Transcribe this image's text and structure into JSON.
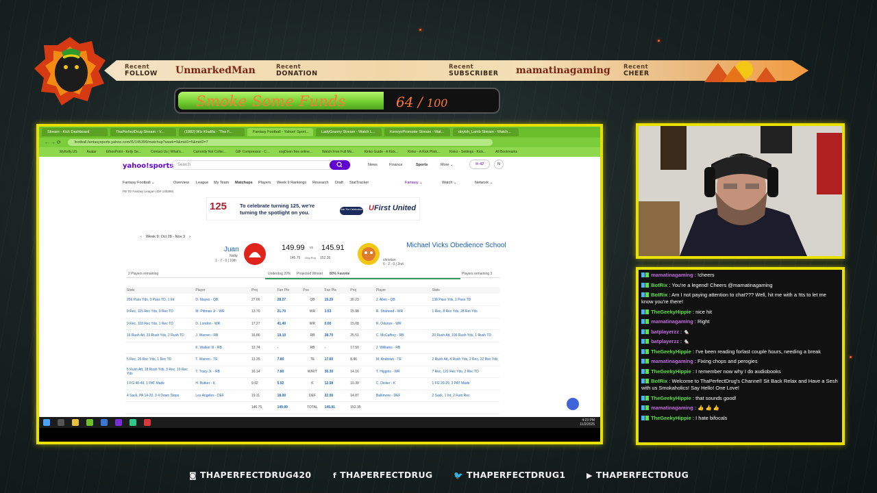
{
  "banner": {
    "follow_label": [
      "Recent",
      "FOLLOW"
    ],
    "follow_name": "UnmarkedMan",
    "donation_label": [
      "Recent",
      "DONATION"
    ],
    "subscriber_label": [
      "Recent",
      "SUBSCRIBER"
    ],
    "subscriber_name": "mamatinagaming",
    "cheer_label": [
      "Recent",
      "CHEER"
    ]
  },
  "goal": {
    "title": "Smoke Some Funds",
    "current": "64",
    "sep": "/",
    "target": "100",
    "progress_fraction": 0.64
  },
  "browser": {
    "tabs": [
      "Stream - Kick Dashboard",
      "ThaPerfectDrug Stream - V...",
      "(1882) Wiz Khalifa - \"The F...",
      "Fantasy Football - Yahoo! Sport...",
      "LadyGranny Stream - Watch L...",
      "KenvynPromoter Stream - Wat...",
      "doylsh_Lamb Stream - Watch..."
    ],
    "url": "football.fantasysports.yahoo.com/f1/145399/matchup?week=9&mid1=5&mid2=7",
    "bookmarks": [
      "MyKelly.US",
      "Avatar",
      "EthosPoint - Kelly Se...",
      "Contact Us | What's...",
      "Currently Not Coller...",
      "GIF Compressor - C...",
      "sogDoon free online...",
      "Watch Free Full Mo...",
      "Kinko Guide - A Kick...",
      "Kinko - A Kick Plink...",
      "Kinko - Settings - Kick...",
      "All Bookmarks"
    ],
    "taskbar_time": "4:23 PM",
    "taskbar_date": "11/2/2025"
  },
  "yahoo": {
    "logo": "yahoo!sports",
    "search_placeholder": "Search",
    "nav": [
      "News",
      "Finance",
      "Sports",
      "More ⌄"
    ],
    "mail_count": "42",
    "sub_nav": [
      "Fantasy Football ⌄",
      "Overview",
      "League",
      "My Team",
      "Matchups",
      "Players",
      "Week 9 Rankings",
      "Research",
      "Draft",
      "StatTracker"
    ],
    "right_nav": [
      "Fantasy ⌄",
      "Watch ⌄",
      "Network ⌄"
    ],
    "league": "PB TD Fantasy League (ID# 145399)",
    "ad_line1": "To celebrate turning 125, we're",
    "ad_line2": "turning the spotlight on you.",
    "ad_button": "Join The Celebration",
    "ad_brand": "First United",
    "ad_125": "125",
    "week": "Week 9: Oct 28 - Nov 3",
    "team_a": "Juan",
    "team_a_owner": "Natty",
    "team_a_record": "1 - 7 - 0 | 10th",
    "score_a": "149.99",
    "score_b": "145.91",
    "proj_a": "146.75",
    "proj_b": "152.35",
    "proj_label": "Orig Proj",
    "vs": "vs",
    "team_b": "Michael Vicks Obedience School",
    "team_b_owner": "christian",
    "team_b_record": "6 - 2 - 0 | 2nd",
    "remaining_a": "2 Players remaining",
    "remaining_b": "Players remaining 3",
    "underdog": "Underdog 20%",
    "proj_winner": "Projected Winner",
    "favorite": "80% Favorite",
    "headers": [
      "Stats",
      "Player",
      "Proj",
      "Fan Pts",
      "Pos",
      "Fan Pts",
      "Proj",
      "Player",
      "Stats"
    ],
    "rows": [
      [
        "256 Pass Yds, 3 Pass TD, 1 Int",
        "D. Mayes - QB",
        "27.66",
        "28.27",
        "QB",
        "15.20",
        "30.23",
        "J. Allen - QB",
        "138 Pass Yds, 1 Pass TD"
      ],
      [
        "9 Rec, 115 Rec Yds, 0 Rec TD",
        "M. Pittman Jr - WR",
        "13.70",
        "21.70",
        "WR",
        "3.53",
        "15.98",
        "R. Shaheed - WR",
        "1 Rec, 8 Rec Yds, 28 Ret Yds"
      ],
      [
        "9 Rec, 118 Rec Yds, 1 Rec TD",
        "D. London - WR",
        "17.27",
        "41.40",
        "WR",
        "0.00",
        "15.08",
        "R. Odunze - WR",
        ""
      ],
      [
        "16 Rush Att, 33 Rush Yds, 2 Rush TD",
        "J. Warren - RB",
        "16.86",
        "19.10",
        "RB",
        "38.70",
        "25.51",
        "C. McCaffrey - RB",
        "20 Rush Att, 106 Rush Yds, 1 Rush TD"
      ],
      [
        "",
        "K. Walker III - RB",
        "12.74",
        "-",
        "RB",
        "-",
        "17.50",
        "J. Williams - RB",
        ""
      ],
      [
        "5 Rec, 26 Rec Yds, 1 Rec TD",
        "T. Warren - TE",
        "13.35",
        "7.80",
        "TE",
        "17.60",
        "8.86",
        "M. Andrews - TE",
        "2 Rush Att, 4 Rush Yds, 2 Rec, 22 Rec Yds"
      ],
      [
        "5 Rush Att, 18 Rush Yds, 3 Rec, 19 Rec Yds",
        "T. Tracy Jr. - RB",
        "16.14",
        "7.80",
        "W/R/T",
        "36.30",
        "14.16",
        "T. Higgins - WR",
        "7 Rec, 121 Rec Yds, 2 Rec TD"
      ],
      [
        "1 FG 40-49, 1 PAT Made",
        "H. Butker - K",
        "9.92",
        "5.92",
        "K",
        "12.58",
        "10.39",
        "C. Dicker - K",
        "1 FG 20-29, 3 PAT Made"
      ],
      [
        "4 Sack, PA 14-20, 3 4 Down Stops",
        "Los Angeles - DEF",
        "19.11",
        "18.00",
        "DEF",
        "22.00",
        "14.87",
        "Baltimore - DEF",
        "2 Sack, 1 Int, 2 Fum Rec"
      ],
      [
        "",
        "",
        "146.75",
        "149.99",
        "TOTAL",
        "145.91",
        "152.35",
        "",
        ""
      ]
    ]
  },
  "chat": [
    {
      "user": "mamatinagaming",
      "color": "#c36be0",
      "text": "!cheers"
    },
    {
      "user": "BotRix",
      "color": "#5ee04a",
      "text": "You're a legend! Cheers @mamatinagaming"
    },
    {
      "user": "BotRix",
      "color": "#5ee04a",
      "text": "Am I not paying attention to chat??? Well, hit me with a !tts to let me know you're there!"
    },
    {
      "user": "TheGeekyHippie",
      "color": "#5ee04a",
      "text": "nice hit"
    },
    {
      "user": "mamatinagaming",
      "color": "#c36be0",
      "text": "Right"
    },
    {
      "user": "batplayerzz",
      "color": "#c36be0",
      "text": "🐁"
    },
    {
      "user": "batplayerzz",
      "color": "#c36be0",
      "text": "🐁"
    },
    {
      "user": "TheGeekyHippie",
      "color": "#5ee04a",
      "text": "I've been reading forlast couple hours, needing a break"
    },
    {
      "user": "mamatinagaming",
      "color": "#c36be0",
      "text": "Fixing chops and perogies"
    },
    {
      "user": "TheGeekyHippie",
      "color": "#5ee04a",
      "text": "I remember now why I do audiobooks"
    },
    {
      "user": "BotRix",
      "color": "#5ee04a",
      "text": "Welcome to ThaPerfectDrug's Channel! Sit Back Relax and Have a Sesh with us Smokaholics! Say Hello! One Love!"
    },
    {
      "user": "TheGeekyHippie",
      "color": "#5ee04a",
      "text": "that sounds good!"
    },
    {
      "user": "mamatinagaming",
      "color": "#c36be0",
      "text": "👍 👍 👍"
    },
    {
      "user": "TheGeekyHippie",
      "color": "#5ee04a",
      "text": "I hate bifocals"
    }
  ],
  "socials": [
    {
      "icon": "instagram-icon",
      "glyph": "◙",
      "handle": "THAPERFECTDRUG420"
    },
    {
      "icon": "facebook-icon",
      "glyph": "f",
      "handle": "THAPERFECTDRUG"
    },
    {
      "icon": "twitter-icon",
      "glyph": "🐦",
      "handle": "THAPERFECTDRUG1"
    },
    {
      "icon": "youtube-icon",
      "glyph": "▶",
      "handle": "THAPERFECTDRUG"
    }
  ],
  "colors": {
    "frame": "#e8e000",
    "goal_fill": "#6fcc2e",
    "goal_text": "#ff7a34",
    "yahoo_purple": "#6001d2"
  }
}
